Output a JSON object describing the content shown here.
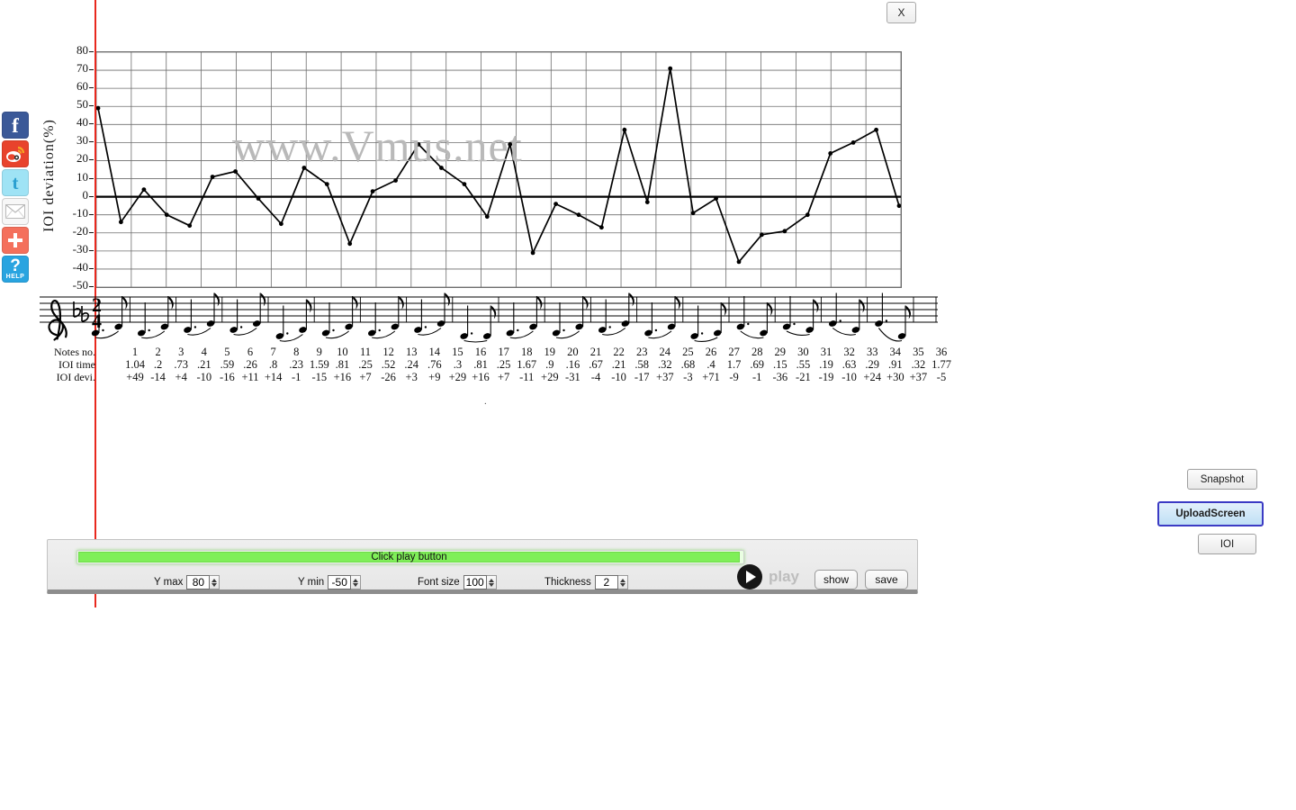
{
  "window": {
    "close_label": "X"
  },
  "social": [
    {
      "name": "facebook-icon",
      "glyph": "f"
    },
    {
      "name": "weibo-icon",
      "glyph": "◉"
    },
    {
      "name": "twitter-icon",
      "glyph": "t"
    },
    {
      "name": "email-icon",
      "glyph": "✉"
    },
    {
      "name": "share-plus-icon",
      "glyph": "✚"
    },
    {
      "name": "help-icon",
      "glyph": "?",
      "sub": "HELP"
    }
  ],
  "watermark": "www.Vmus.net",
  "chart_data": {
    "type": "line",
    "title": "",
    "xlabel": "",
    "ylabel": "IOI  deviation(%)",
    "ylim": [
      -50,
      80
    ],
    "yticks": [
      80,
      70,
      60,
      50,
      40,
      30,
      20,
      10,
      0,
      -10,
      -20,
      -30,
      -40,
      -50
    ],
    "grid": true,
    "zero_line": true,
    "x": [
      1,
      2,
      3,
      4,
      5,
      6,
      7,
      8,
      9,
      10,
      11,
      12,
      13,
      14,
      15,
      16,
      17,
      18,
      19,
      20,
      21,
      22,
      23,
      24,
      25,
      26,
      27,
      28,
      29,
      30,
      31,
      32,
      33,
      34,
      35,
      36
    ],
    "values": [
      49,
      -14,
      4,
      -10,
      -16,
      11,
      14,
      -1,
      -15,
      16,
      7,
      -26,
      3,
      9,
      29,
      16,
      7,
      -11,
      29,
      -31,
      -4,
      -10,
      -17,
      37,
      -3,
      71,
      -9,
      -1,
      -36,
      -21,
      -19,
      -10,
      24,
      30,
      37,
      -5
    ]
  },
  "table": {
    "row_labels": [
      "Notes no.",
      "IOI time",
      "IOI devi."
    ],
    "notes_no": [
      "1",
      "2",
      "3",
      "4",
      "5",
      "6",
      "7",
      "8",
      "9",
      "10",
      "11",
      "12",
      "13",
      "14",
      "15",
      "16",
      "17",
      "18",
      "19",
      "20",
      "21",
      "22",
      "23",
      "24",
      "25",
      "26",
      "27",
      "28",
      "29",
      "30",
      "31",
      "32",
      "33",
      "34",
      "35",
      "36"
    ],
    "ioi_time": [
      "1.04",
      ".2",
      ".73",
      ".21",
      ".59",
      ".26",
      ".8",
      ".23",
      "1.59",
      ".81",
      ".25",
      ".52",
      ".24",
      ".76",
      ".3",
      ".81",
      ".25",
      "1.67",
      ".9",
      ".16",
      ".67",
      ".21",
      ".58",
      ".32",
      ".68",
      ".4",
      "1.7",
      ".69",
      ".15",
      ".55",
      ".19",
      ".63",
      ".29",
      ".91",
      ".32",
      "1.77"
    ],
    "ioi_devi": [
      "+49",
      "-14",
      "+4",
      "-10",
      "-16",
      "+11",
      "+14",
      "-1",
      "-15",
      "+16",
      "+7",
      "-26",
      "+3",
      "+9",
      "+29",
      "+16",
      "+7",
      "-11",
      "+29",
      "-31",
      "-4",
      "-10",
      "-17",
      "+37",
      "-3",
      "+71",
      "-9",
      "-1",
      "-36",
      "-21",
      "-19",
      "-10",
      "+24",
      "+30",
      "+37",
      "-5"
    ]
  },
  "score": {
    "clef": "treble-clef",
    "key_signature": "two-flats",
    "time_signature": "2/4"
  },
  "player": {
    "progress_text": "Click play button",
    "progress_percent": 100,
    "play_label": "play",
    "show_label": "show",
    "save_label": "save",
    "controls": [
      {
        "label": "Y max",
        "value": "80"
      },
      {
        "label": "Y min",
        "value": "-50"
      },
      {
        "label": "Font size",
        "value": "100"
      },
      {
        "label": "Thickness",
        "value": "2"
      }
    ]
  },
  "side_buttons": {
    "snapshot": "Snapshot",
    "upload": "UploadScreen",
    "ioi": "IOI"
  },
  "colors": {
    "progress_green": "#7fef58",
    "cursor_red": "#e8281e",
    "upload_border": "#3b3bc4",
    "watermark_gray": "#b9b9b9"
  }
}
